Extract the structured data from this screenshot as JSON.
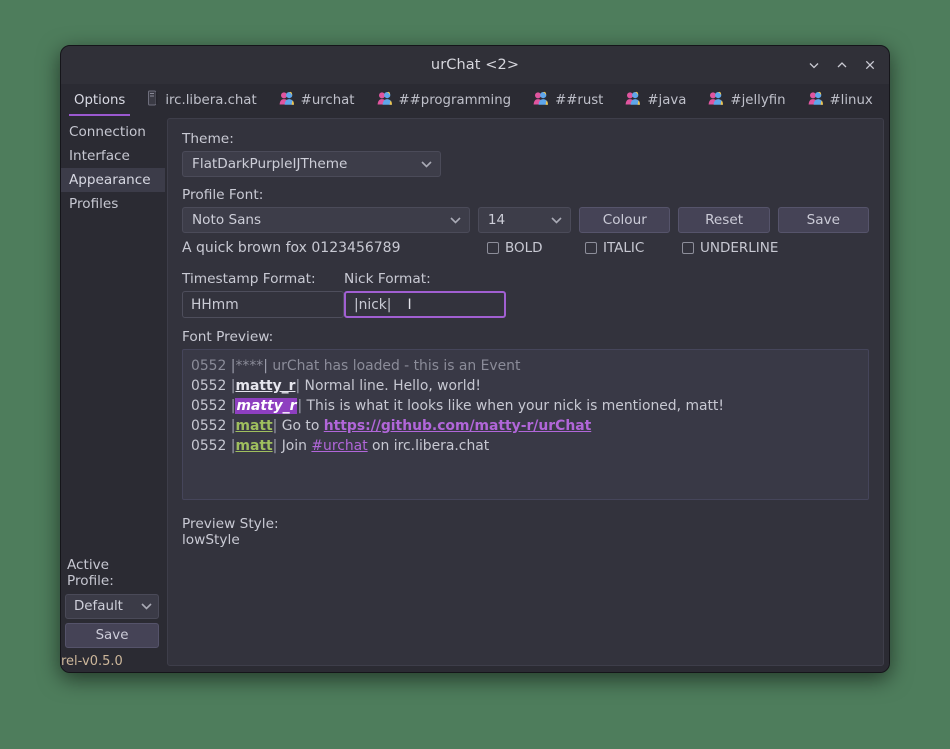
{
  "window": {
    "title": "urChat <2>",
    "controls": [
      {
        "name": "minimize",
        "glyph": "chevron-down"
      },
      {
        "name": "maximize",
        "glyph": "chevron-up"
      },
      {
        "name": "close",
        "glyph": "x"
      }
    ]
  },
  "tabs": [
    {
      "label": "Options",
      "icon": "none",
      "active": true
    },
    {
      "label": "irc.libera.chat",
      "icon": "server-icon",
      "active": false
    },
    {
      "label": "#urchat",
      "icon": "users-icon",
      "active": false
    },
    {
      "label": "##programming",
      "icon": "users-icon",
      "active": false
    },
    {
      "label": "##rust",
      "icon": "users-icon",
      "active": false
    },
    {
      "label": "#java",
      "icon": "users-icon",
      "active": false
    },
    {
      "label": "#jellyfin",
      "icon": "users-icon",
      "active": false
    },
    {
      "label": "#linux",
      "icon": "users-icon",
      "active": false
    }
  ],
  "tab_nav": {
    "scroll_forward": "chevron-right-icon",
    "tab_list": "chevron-down-icon"
  },
  "sidebar": {
    "items": [
      {
        "label": "Connection",
        "selected": false
      },
      {
        "label": "Interface",
        "selected": false
      },
      {
        "label": "Appearance",
        "selected": true
      },
      {
        "label": "Profiles",
        "selected": false
      }
    ],
    "active_profile_label": "Active Profile:",
    "active_profile_value": "Default",
    "save_label": "Save",
    "version": "rel-v0.5.0"
  },
  "appearance": {
    "theme_label": "Theme:",
    "theme_value": "FlatDarkPurpleIJTheme",
    "profile_font_label": "Profile Font:",
    "font_family_value": "Noto Sans",
    "font_size_value": "14",
    "colour_label": "Colour",
    "reset_label": "Reset",
    "save_label": "Save",
    "sample_text": "A quick brown fox 0123456789",
    "bold_label": "BOLD",
    "italic_label": "ITALIC",
    "underline_label": "UNDERLINE",
    "bold_checked": false,
    "italic_checked": false,
    "underline_checked": false,
    "timestamp_label": "Timestamp Format:",
    "timestamp_value": "HHmm",
    "nick_label": "Nick Format:",
    "nick_value": "|nick|",
    "nick_focused": true,
    "font_preview_label": "Font Preview:",
    "preview_style_label": "Preview Style:",
    "preview_style_value": "lowStyle"
  },
  "preview_lines": [
    {
      "timestamp": "0552",
      "nick": "****",
      "nick_style": "event",
      "segments": [
        {
          "text": " urChat has loaded - this is an Event",
          "style": "event"
        }
      ]
    },
    {
      "timestamp": "0552",
      "nick": "matty_r",
      "nick_style": "plain",
      "segments": [
        {
          "text": " Normal line. Hello, world!",
          "style": "normal"
        }
      ]
    },
    {
      "timestamp": "0552",
      "nick": "matty_r",
      "nick_style": "highlight",
      "segments": [
        {
          "text": " This is what it looks like when your nick is mentioned, matt!",
          "style": "normal"
        }
      ]
    },
    {
      "timestamp": "0552",
      "nick": "matt",
      "nick_style": "green",
      "segments": [
        {
          "text": " Go to ",
          "style": "normal"
        },
        {
          "text": "https://github.com/matty-r/urChat",
          "style": "link"
        }
      ]
    },
    {
      "timestamp": "0552",
      "nick": "matt",
      "nick_style": "green",
      "segments": [
        {
          "text": " Join ",
          "style": "normal"
        },
        {
          "text": "#urchat",
          "style": "link-channel"
        },
        {
          "text": " on irc.libera.chat",
          "style": "normal"
        }
      ]
    }
  ],
  "colors": {
    "desktop": "#4e7d5c",
    "window_bg": "#2b2b33",
    "titlebar": "#303038",
    "panel": "#33333d",
    "accent_purple": "#9b59d0",
    "highlight_bg": "#8e3fc0",
    "nick_green": "#9fbf5e",
    "link_purple": "#b166d9",
    "version_text": "#cdb79b"
  }
}
